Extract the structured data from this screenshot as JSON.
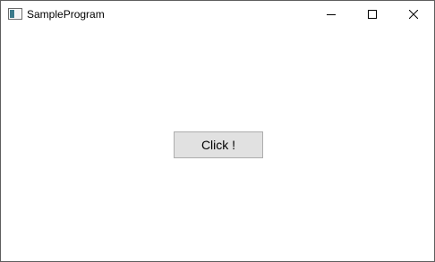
{
  "window": {
    "title": "SampleProgram",
    "app_icon": "window-app-icon",
    "controls": {
      "minimize_icon": "minimize-icon",
      "maximize_icon": "maximize-icon",
      "close_icon": "close-icon"
    }
  },
  "main": {
    "click_button_label": "Click !"
  },
  "colors": {
    "button_face": "#e1e1e1",
    "button_border": "#adadad",
    "window_background": "#ffffff"
  }
}
